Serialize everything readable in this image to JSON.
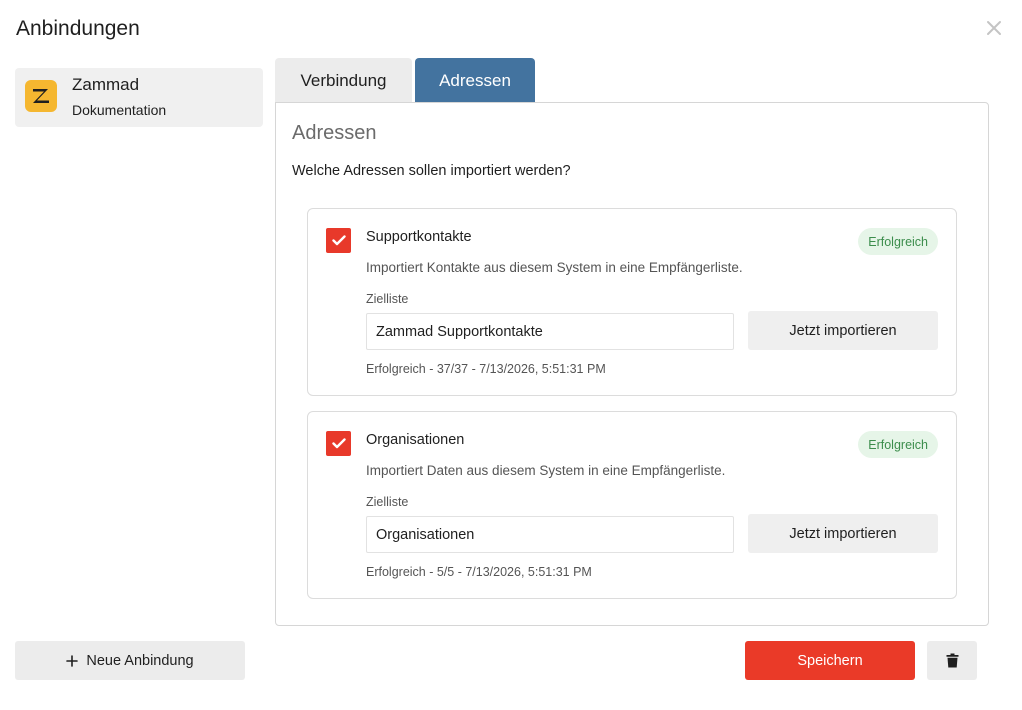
{
  "dialog": {
    "title": "Anbindungen",
    "close_icon": "close-icon"
  },
  "sidebar": {
    "items": [
      {
        "name": "Zammad",
        "subtitle": "Dokumentation",
        "logo_letter": "Z",
        "logo_color": "#f5b730"
      }
    ]
  },
  "tabs": [
    {
      "label": "Verbindung",
      "active": false
    },
    {
      "label": "Adressen",
      "active": true
    }
  ],
  "panel": {
    "heading": "Adressen",
    "question": "Welche Adressen sollen importiert werden?",
    "cards": [
      {
        "title": "Supportkontakte",
        "checked": true,
        "status": "Erfolgreich",
        "description": "Importiert Kontakte aus diesem System in eine Empfängerliste.",
        "field_label": "Zielliste",
        "target_value": "Zammad Supportkontakte",
        "import_label": "Jetzt importieren",
        "last_result": "Erfolgreich - 37/37 - 7/13/2026, 5:51:31 PM"
      },
      {
        "title": "Organisationen",
        "checked": true,
        "status": "Erfolgreich",
        "description": "Importiert Daten aus diesem System in eine Empfängerliste.",
        "field_label": "Zielliste",
        "target_value": "Organisationen",
        "import_label": "Jetzt importieren",
        "last_result": "Erfolgreich - 5/5 - 7/13/2026, 5:51:31 PM"
      }
    ]
  },
  "footer": {
    "new_label": "Neue Anbindung",
    "save_label": "Speichern",
    "delete_icon": "trash-icon"
  },
  "colors": {
    "accent_tab": "#43739f",
    "primary": "#ea3a28",
    "checkbox": "#e8392a",
    "success_bg": "#e6f5e8",
    "success_text": "#3c8d4c"
  }
}
